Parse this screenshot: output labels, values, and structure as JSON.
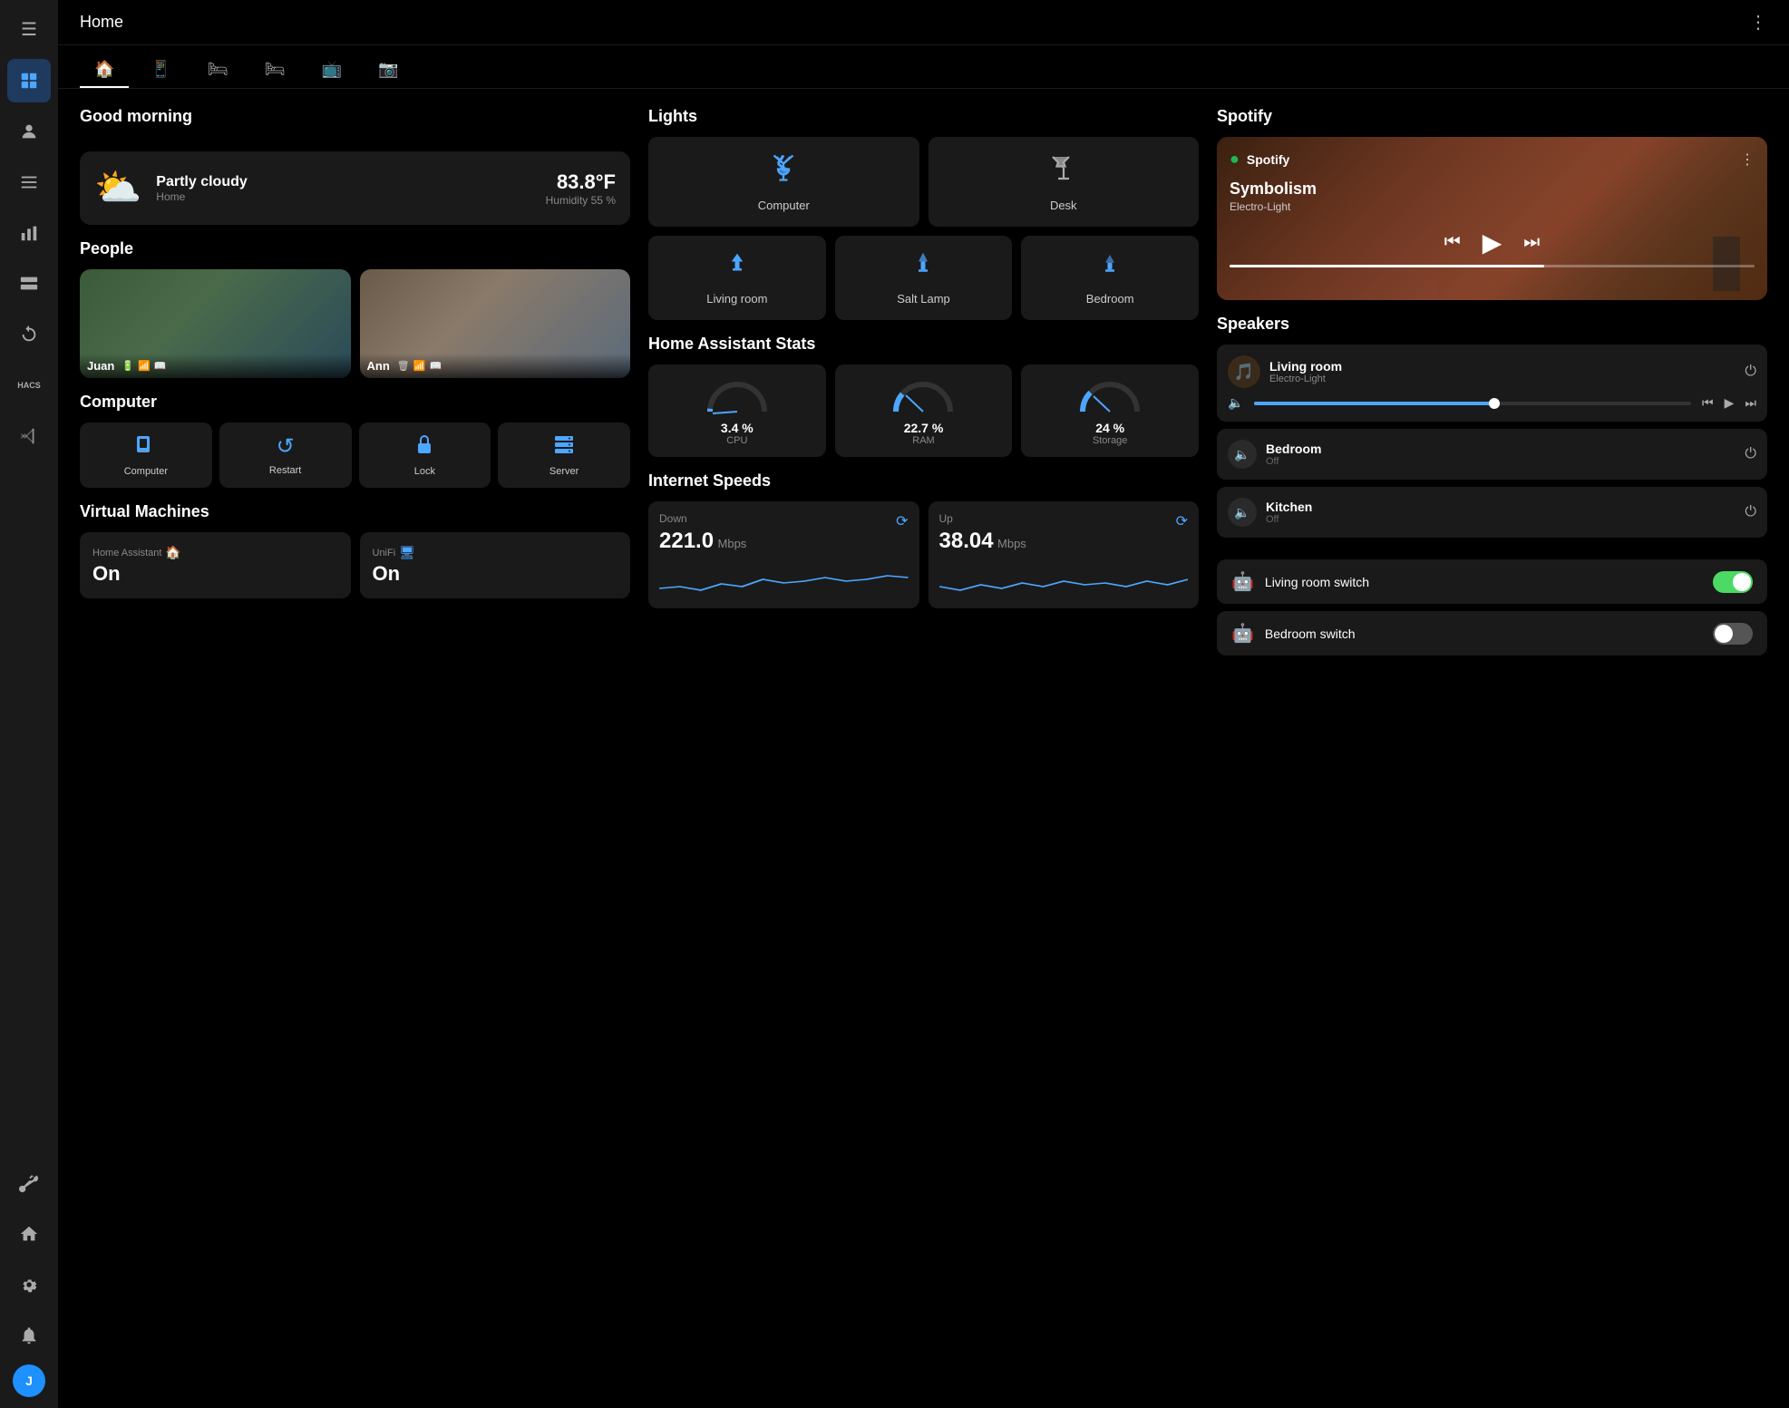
{
  "app": {
    "title": "Home",
    "more_icon": "⋮"
  },
  "sidebar": {
    "menu_icon": "☰",
    "items": [
      {
        "id": "dashboard",
        "icon": "⊞",
        "active": true
      },
      {
        "id": "person",
        "icon": "👤",
        "active": false
      },
      {
        "id": "list",
        "icon": "☰",
        "active": false
      },
      {
        "id": "chart",
        "icon": "📊",
        "active": false
      },
      {
        "id": "server",
        "icon": "🖥",
        "active": false
      },
      {
        "id": "refresh",
        "icon": "↻",
        "active": false
      },
      {
        "id": "hacs",
        "icon": "HACS",
        "active": false
      },
      {
        "id": "vscode",
        "icon": "◧",
        "active": false
      }
    ],
    "bottom": [
      {
        "id": "wrench",
        "icon": "🔧"
      },
      {
        "id": "home",
        "icon": "🏠"
      },
      {
        "id": "settings",
        "icon": "⚙"
      },
      {
        "id": "notifications",
        "icon": "🔔"
      },
      {
        "id": "avatar",
        "label": "J"
      }
    ]
  },
  "nav_tabs": [
    {
      "icon": "🏠",
      "active": true
    },
    {
      "icon": "📱",
      "active": false
    },
    {
      "icon": "🛏",
      "active": false
    },
    {
      "icon": "🛏",
      "active": false
    },
    {
      "icon": "📺",
      "active": false
    },
    {
      "icon": "📷",
      "active": false
    }
  ],
  "greeting": {
    "title": "Good morning"
  },
  "weather": {
    "icon": "⛅",
    "condition": "Partly cloudy",
    "location": "Home",
    "temperature": "83.8°F",
    "humidity": "Humidity 55 %"
  },
  "people": {
    "title": "People",
    "persons": [
      {
        "name": "Juan",
        "icons": [
          "🔋",
          "📶",
          "📖"
        ]
      },
      {
        "name": "Ann",
        "icons": [
          "🗑",
          "📶",
          "📖"
        ]
      }
    ]
  },
  "computer": {
    "title": "Computer",
    "buttons": [
      {
        "id": "computer",
        "icon": "💻",
        "label": "Computer"
      },
      {
        "id": "restart",
        "icon": "↺",
        "label": "Restart"
      },
      {
        "id": "lock",
        "icon": "🔒",
        "label": "Lock"
      },
      {
        "id": "server",
        "icon": "🗄",
        "label": "Server"
      }
    ]
  },
  "virtual_machines": {
    "title": "Virtual Machines",
    "vms": [
      {
        "name": "Home Assistant",
        "icon": "🏠",
        "status": "On"
      },
      {
        "name": "UniFi",
        "icon": "🖥",
        "status": "On"
      }
    ]
  },
  "lights": {
    "title": "Lights",
    "buttons_row1": [
      {
        "id": "computer-light",
        "icon": "💡",
        "label": "Computer"
      },
      {
        "id": "desk-light",
        "icon": "💡",
        "label": "Desk"
      }
    ],
    "buttons_row2": [
      {
        "id": "living-room-light",
        "icon": "🔦",
        "label": "Living room"
      },
      {
        "id": "salt-lamp-light",
        "icon": "🔦",
        "label": "Salt Lamp"
      },
      {
        "id": "bedroom-light",
        "icon": "🔦",
        "label": "Bedroom"
      }
    ]
  },
  "ha_stats": {
    "title": "Home Assistant Stats",
    "stats": [
      {
        "id": "cpu",
        "value": "3.4 %",
        "label": "CPU",
        "percent": 3.4,
        "color": "#4da6ff"
      },
      {
        "id": "ram",
        "value": "22.7 %",
        "label": "RAM",
        "percent": 22.7,
        "color": "#4da6ff"
      },
      {
        "id": "storage",
        "value": "24 %",
        "label": "Storage",
        "percent": 24,
        "color": "#4da6ff"
      }
    ]
  },
  "internet": {
    "title": "Internet Speeds",
    "down": {
      "label": "Down",
      "value": "221.0",
      "unit": "Mbps"
    },
    "up": {
      "label": "Up",
      "value": "38.04",
      "unit": "Mbps"
    }
  },
  "spotify": {
    "title": "Spotify",
    "app_name": "Spotify",
    "track": "Symbolism",
    "artist": "Electro-Light",
    "progress": 60
  },
  "speakers": {
    "title": "Speakers",
    "items": [
      {
        "name": "Living room",
        "track": "Electro-Light",
        "volume": 55,
        "has_controls": true
      },
      {
        "name": "Bedroom",
        "track": "Off",
        "has_controls": false
      },
      {
        "name": "Kitchen",
        "track": "Off",
        "has_controls": false
      }
    ]
  },
  "switches": {
    "items": [
      {
        "name": "Living room switch",
        "on": true
      },
      {
        "name": "Bedroom switch",
        "on": false
      }
    ]
  }
}
